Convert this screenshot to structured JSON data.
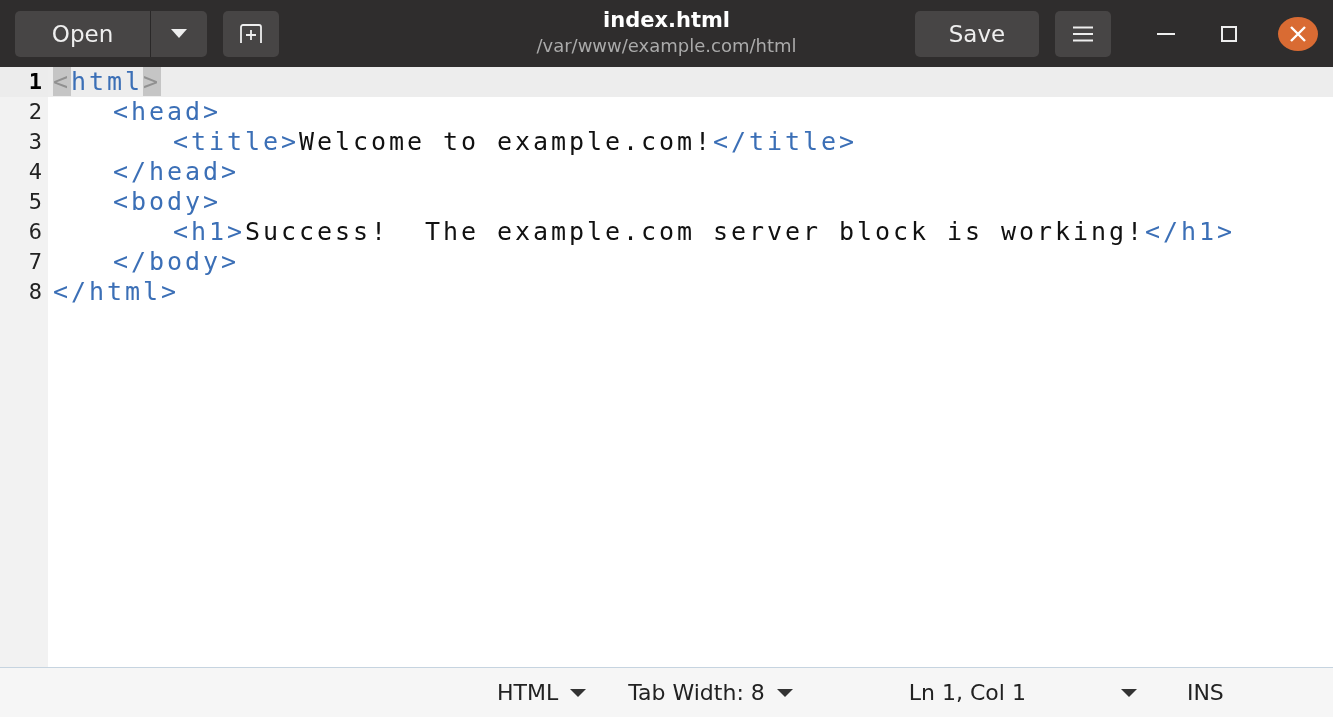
{
  "header": {
    "open_button": "Open",
    "title": "index.html",
    "subtitle": "/var/www/example.com/html",
    "save_button": "Save"
  },
  "editor": {
    "lines": [
      {
        "number": "1",
        "current": true,
        "tokens": [
          {
            "kind": "bracket",
            "text": "<",
            "matched": true
          },
          {
            "kind": "tag",
            "text": "html"
          },
          {
            "kind": "bracket",
            "text": ">",
            "matched": true
          }
        ],
        "children": [
          {
            "number": "2",
            "current": false,
            "tokens": [
              {
                "kind": "tag",
                "text": "<head>"
              }
            ],
            "children": [
              {
                "number": "3",
                "current": false,
                "tokens": [
                  {
                    "kind": "tag",
                    "text": "<title>"
                  },
                  {
                    "kind": "text",
                    "text": "Welcome to example.com!"
                  },
                  {
                    "kind": "tag",
                    "text": "</title>"
                  }
                ]
              }
            ]
          },
          {
            "number": "4",
            "current": false,
            "tokens": [
              {
                "kind": "tag",
                "text": "</head>"
              }
            ]
          },
          {
            "number": "5",
            "current": false,
            "tokens": [
              {
                "kind": "tag",
                "text": "<body>"
              }
            ],
            "children": [
              {
                "number": "6",
                "current": false,
                "tokens": [
                  {
                    "kind": "tag",
                    "text": "<h1>"
                  },
                  {
                    "kind": "text",
                    "text": "Success!  The example.com server block is working!"
                  },
                  {
                    "kind": "tag",
                    "text": "</h1>"
                  }
                ]
              }
            ]
          },
          {
            "number": "7",
            "current": false,
            "tokens": [
              {
                "kind": "tag",
                "text": "</body>"
              }
            ]
          }
        ]
      },
      {
        "number": "8",
        "current": false,
        "tokens": [
          {
            "kind": "tag",
            "text": "</html>"
          }
        ]
      }
    ]
  },
  "status_bar": {
    "language": "HTML",
    "tab_width": "Tab Width: 8",
    "position": "Ln 1, Col 1",
    "mode": "INS"
  }
}
